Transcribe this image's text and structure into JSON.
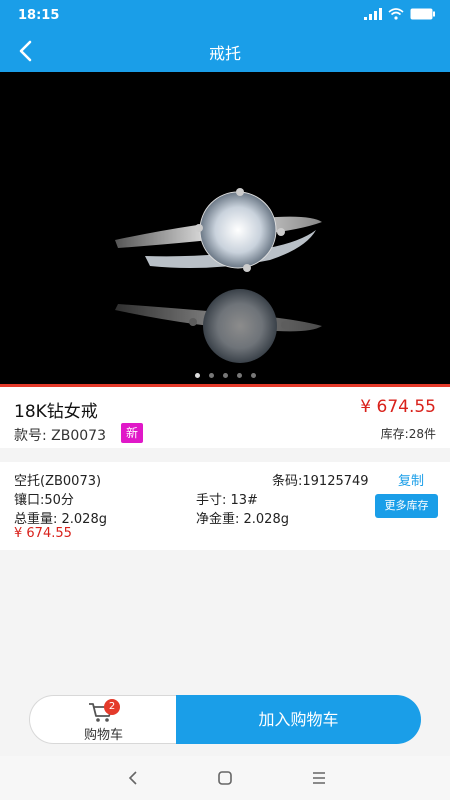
{
  "status_bar": {
    "time": "18:15"
  },
  "nav": {
    "title": "戒托"
  },
  "gallery": {
    "image_count": 5,
    "active_index": 0
  },
  "product": {
    "name": "18K钻女戒",
    "price": "¥ 674.55",
    "style_no": "款号: ZB0073",
    "badge": "新",
    "stock": "库存:28件"
  },
  "spec": {
    "setting": "空托(ZB0073)",
    "barcode": "条码:19125749",
    "copy_label": "复制",
    "mount": "镶口:50分",
    "size": "手寸: 13#",
    "more_stock_label": "更多库存",
    "total_weight": "总重量: 2.028g",
    "net_gold_weight": "净金重: 2.028g",
    "price": "¥ 674.55"
  },
  "bottom_bar": {
    "cart_label": "购物车",
    "cart_count": "2",
    "add_to_cart_label": "加入购物车"
  },
  "colors": {
    "primary": "#1a9ee8",
    "price": "#d9211b",
    "badge": "#e018c8"
  }
}
